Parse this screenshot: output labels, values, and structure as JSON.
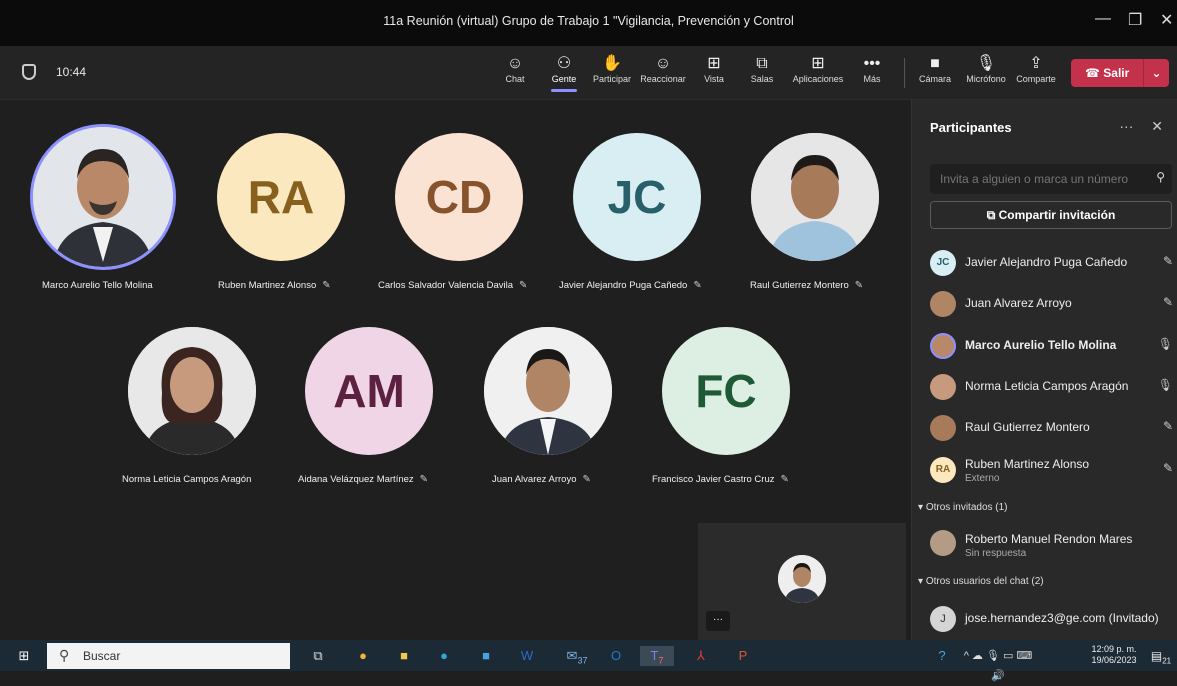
{
  "window": {
    "title": "11a Reunión (virtual) Grupo de Trabajo 1 \"Vigilancia, Prevención y Control",
    "minimize": "—",
    "maximize": "❐",
    "close": "✕"
  },
  "toolbar": {
    "time": "10:44",
    "buttons": [
      {
        "label": "Chat",
        "icon": "☺"
      },
      {
        "label": "Gente",
        "icon": "⚇"
      },
      {
        "label": "Participar",
        "icon": "✋"
      },
      {
        "label": "Reaccionar",
        "icon": "☺"
      },
      {
        "label": "Vista",
        "icon": "⊞"
      },
      {
        "label": "Salas",
        "icon": "⧉"
      },
      {
        "label": "Aplicaciones",
        "icon": "⊞"
      },
      {
        "label": "Más",
        "icon": "•••"
      },
      {
        "label": "Cámara",
        "icon": "■"
      },
      {
        "label": "Micrófono",
        "icon": "🎙"
      },
      {
        "label": "Comparte",
        "icon": "⇪"
      }
    ],
    "leave_label": "Salir",
    "leave_icon": "☎",
    "leave_chevron": "⌄"
  },
  "stage": {
    "tiles": [
      {
        "name": "Marco Aurelio Tello Molina",
        "initials": "",
        "muted": false
      },
      {
        "name": "Ruben Martinez Alonso",
        "initials": "RA",
        "muted": true
      },
      {
        "name": "Carlos Salvador Valencia Davila",
        "initials": "CD",
        "muted": true
      },
      {
        "name": "Javier Alejandro Puga Cañedo",
        "initials": "JC",
        "muted": true
      },
      {
        "name": "Raul Gutierrez Montero",
        "initials": "",
        "muted": true
      },
      {
        "name": "Norma Leticia Campos Aragón",
        "initials": "",
        "muted": false
      },
      {
        "name": "Aidana Velázquez Martínez",
        "initials": "AM",
        "muted": true
      },
      {
        "name": "Juan Alvarez Arroyo",
        "initials": "",
        "muted": true
      },
      {
        "name": "Francisco Javier Castro Cruz",
        "initials": "FC",
        "muted": true
      }
    ],
    "mute_icon": "✎",
    "selfview_more": "···"
  },
  "panel": {
    "title": "Participantes",
    "more_icon": "···",
    "close_icon": "✕",
    "search_placeholder": "Invita a alguien o marca un número",
    "share_label": "Compartir invitación",
    "participants": [
      {
        "name": "Javier Alejandro Puga Cañedo",
        "initials": "JC",
        "sub": "",
        "state": "muted"
      },
      {
        "name": "Juan Alvarez Arroyo",
        "initials": "",
        "sub": "",
        "state": "muted"
      },
      {
        "name": "Marco Aurelio Tello Molina",
        "initials": "",
        "sub": "",
        "state": "speaking"
      },
      {
        "name": "Norma Leticia Campos Aragón",
        "initials": "",
        "sub": "",
        "state": "mic"
      },
      {
        "name": "Raul Gutierrez Montero",
        "initials": "",
        "sub": "",
        "state": "muted"
      },
      {
        "name": "Ruben Martinez Alonso",
        "initials": "RA",
        "sub": "Externo",
        "state": "muted"
      }
    ],
    "other_guests_label": "Otros invitados (1)",
    "other_guests": [
      {
        "name": "Roberto Manuel Rendon Mares",
        "sub": "Sin respuesta"
      }
    ],
    "chat_users_label": "Otros usuarios del chat (2)",
    "chat_users": [
      {
        "name": "jose.hernandez3@ge.com (Invitado)",
        "initials": "J"
      }
    ]
  },
  "taskbar": {
    "search_label": "Buscar",
    "time": "12:09 p. m.",
    "date": "19/06/2023",
    "mail_badge": "37",
    "teams_badge": "7",
    "notif_badge": "21"
  },
  "colors": {
    "accent": "#8d91ff",
    "leave": "#c4314b",
    "ra_bg": "#fbe8bf",
    "ra_fg": "#86601c",
    "cd_bg": "#fbe3d3",
    "cd_fg": "#87532d",
    "jc_bg": "#d8eef3",
    "jc_fg": "#27606a",
    "am_bg": "#efd5e6",
    "am_fg": "#5c2040",
    "fc_bg": "#dcefe2",
    "fc_fg": "#1f5a37"
  }
}
